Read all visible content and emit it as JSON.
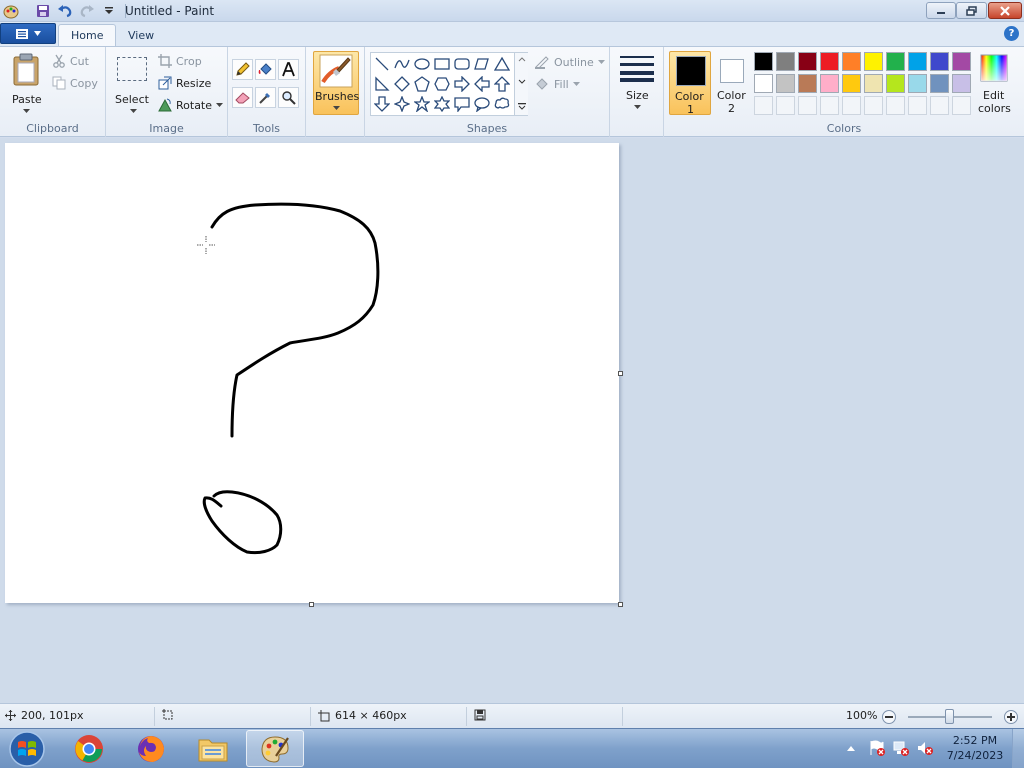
{
  "window": {
    "title": "Untitled - Paint"
  },
  "tabs": [
    {
      "label": "Home"
    },
    {
      "label": "View"
    }
  ],
  "help_label": "?",
  "clipboard": {
    "paste": "Paste",
    "cut": "Cut",
    "copy": "Copy",
    "group": "Clipboard"
  },
  "image": {
    "select": "Select",
    "crop": "Crop",
    "resize": "Resize",
    "rotate": "Rotate",
    "group": "Image"
  },
  "tools": {
    "group": "Tools"
  },
  "brushes": {
    "label": "Brushes"
  },
  "shapes": {
    "outline": "Outline",
    "fill": "Fill",
    "group": "Shapes"
  },
  "size": {
    "label": "Size"
  },
  "colors": {
    "color1_line1": "Color",
    "color1_line2": "1",
    "color2_line1": "Color",
    "color2_line2": "2",
    "edit_line1": "Edit",
    "edit_line2": "colors",
    "group": "Colors",
    "color1_value": "#000000",
    "color2_value": "#ffffff",
    "palette_row1": [
      "#000000",
      "#7f7f7f",
      "#880015",
      "#ed1c24",
      "#ff7f27",
      "#fff200",
      "#22b14c",
      "#00a2e8",
      "#3f48cc",
      "#a349a4"
    ],
    "palette_row2": [
      "#ffffff",
      "#c3c3c3",
      "#b97a57",
      "#ffaec9",
      "#ffc90e",
      "#efe4b0",
      "#b5e61d",
      "#99d9ea",
      "#7092be",
      "#c8bfe7"
    ]
  },
  "status": {
    "cursor_pos": "200, 101px",
    "canvas_size": "614 × 460px",
    "zoom": "100%"
  },
  "taskbar": {
    "time": "2:52 PM",
    "date": "7/24/2023"
  }
}
